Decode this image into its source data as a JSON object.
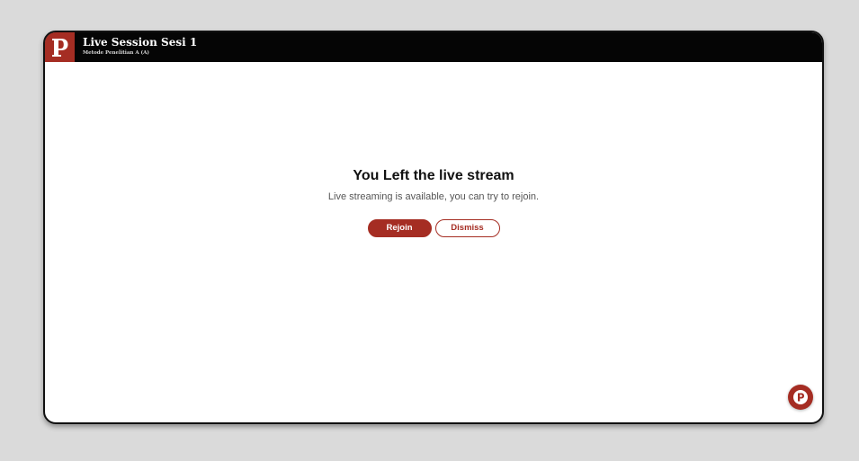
{
  "app": {
    "title": "Live Session Sesi 1",
    "subtitle": "Metode Penelitian A (A)",
    "logo_icon": "p-logo-icon",
    "brand_color": "#a52d23"
  },
  "notice": {
    "heading": "You Left the live stream",
    "message": "Live streaming is available, you can try to rejoin."
  },
  "actions": {
    "rejoin_label": "Rejoin",
    "dismiss_label": "Dismiss"
  },
  "fab": {
    "icon": "p-chat-icon"
  }
}
